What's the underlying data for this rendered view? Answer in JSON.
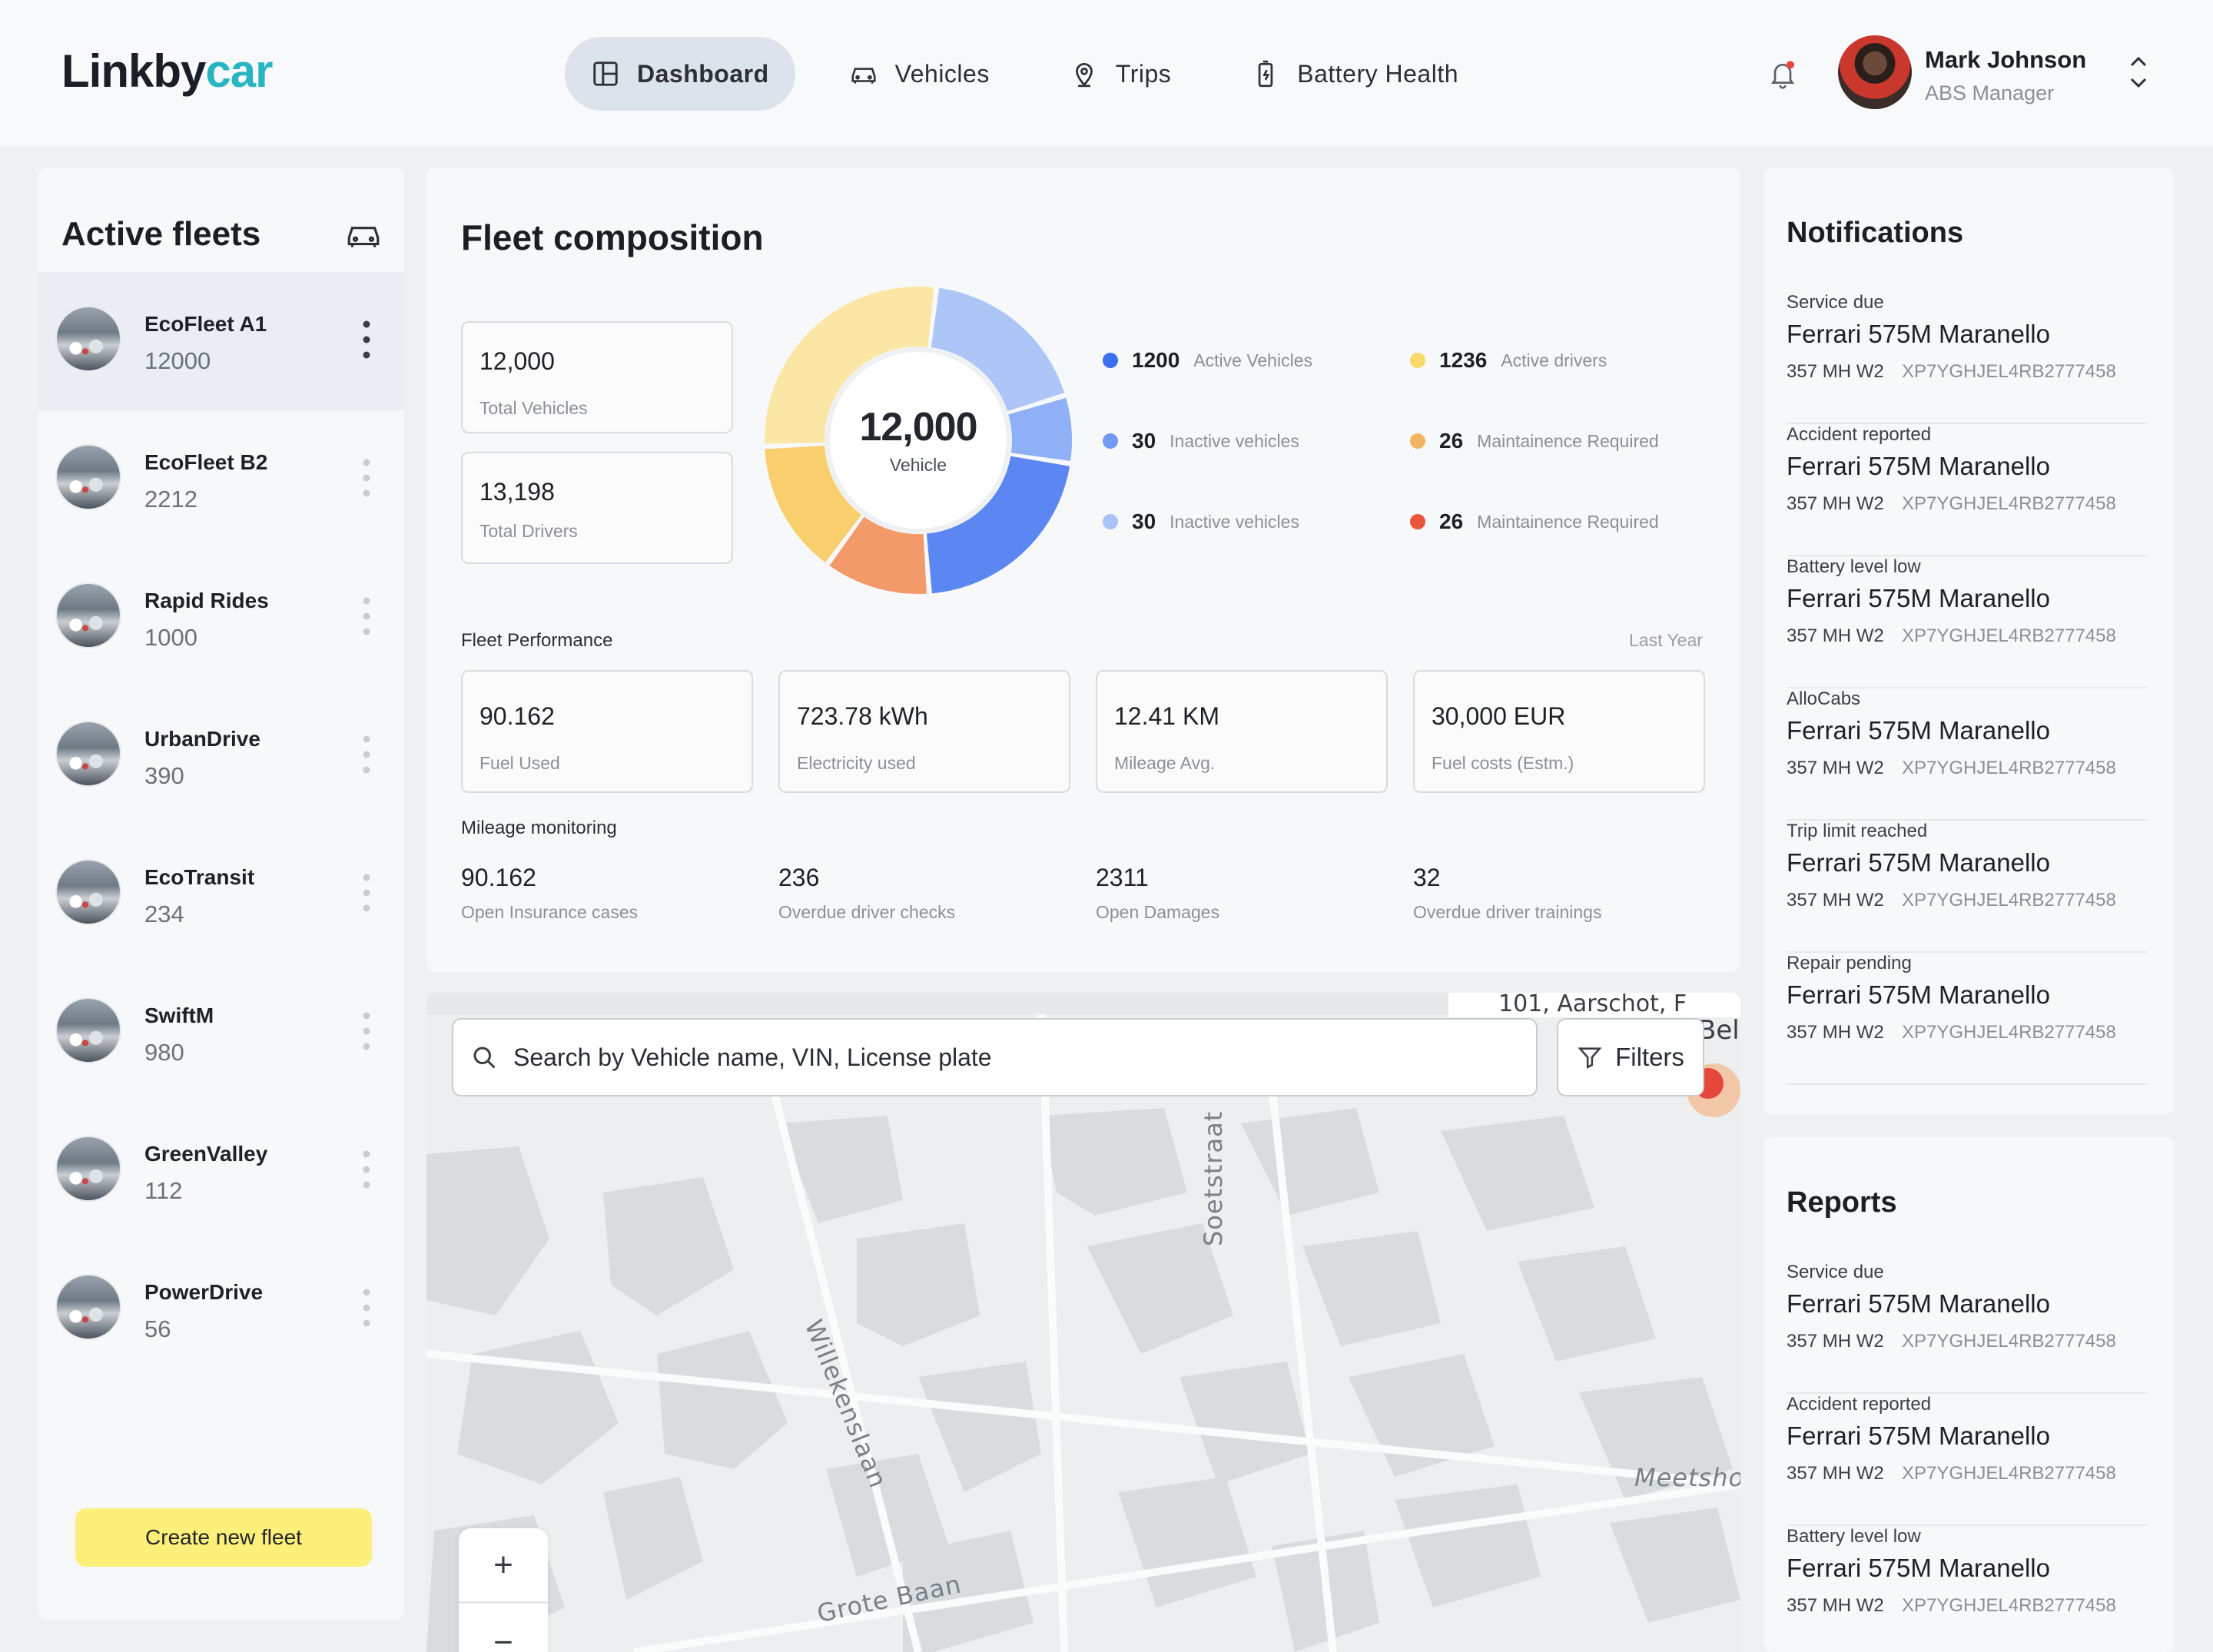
{
  "header": {
    "logo_main": "Linkby",
    "logo_accent": "car",
    "nav": [
      {
        "label": "Dashboard",
        "icon": "dashboard-icon",
        "active": true
      },
      {
        "label": "Vehicles",
        "icon": "car-icon",
        "active": false
      },
      {
        "label": "Trips",
        "icon": "location-pin-icon",
        "active": false
      },
      {
        "label": "Battery Health",
        "icon": "battery-icon",
        "active": false
      }
    ],
    "user": {
      "name": "Mark Johnson",
      "role": "ABS Manager"
    }
  },
  "fleets": {
    "title": "Active fleets",
    "items": [
      {
        "name": "EcoFleet A1",
        "count": "12000",
        "selected": true
      },
      {
        "name": "EcoFleet B2",
        "count": "2212",
        "selected": false
      },
      {
        "name": "Rapid Rides",
        "count": "1000",
        "selected": false
      },
      {
        "name": "UrbanDrive",
        "count": "390",
        "selected": false
      },
      {
        "name": "EcoTransit",
        "count": "234",
        "selected": false
      },
      {
        "name": "SwiftM",
        "count": "980",
        "selected": false
      },
      {
        "name": "GreenValley",
        "count": "112",
        "selected": false
      },
      {
        "name": "PowerDrive",
        "count": "56",
        "selected": false
      }
    ],
    "create_label": "Create new fleet"
  },
  "composition": {
    "title": "Fleet composition",
    "total_vehicles": {
      "value": "12,000",
      "label": "Total Vehicles"
    },
    "total_drivers": {
      "value": "13,198",
      "label": "Total Drivers"
    },
    "donut_center": {
      "value": "12,000",
      "label": "Vehicle"
    },
    "legend": [
      {
        "value": "1200",
        "label": "Active Vehicles",
        "color": "#3d6ff5"
      },
      {
        "value": "1236",
        "label": "Active drivers",
        "color": "#f7da6b"
      },
      {
        "value": "30",
        "label": "Inactive vehicles",
        "color": "#6f9af5"
      },
      {
        "value": "26",
        "label": "Maintainence Required",
        "color": "#f4b363"
      },
      {
        "value": "30",
        "label": "Inactive vehicles",
        "color": "#a9c3f6"
      },
      {
        "value": "26",
        "label": "Maintainence Required",
        "color": "#e8563b"
      }
    ],
    "performance": {
      "label": "Fleet Performance",
      "period": "Last Year",
      "items": [
        {
          "value": "90.162",
          "label": "Fuel Used"
        },
        {
          "value": "723.78 kWh",
          "label": "Electricity used"
        },
        {
          "value": "12.41 KM",
          "label": "Mileage Avg."
        },
        {
          "value": "30,000 EUR",
          "label": "Fuel costs (Estm.)"
        }
      ]
    },
    "mileage": {
      "label": "Mileage monitoring",
      "items": [
        {
          "value": "90.162",
          "label": "Open Insurance cases"
        },
        {
          "value": "236",
          "label": "Overdue driver checks"
        },
        {
          "value": "2311",
          "label": "Open Damages"
        },
        {
          "value": "32",
          "label": "Overdue driver trainings"
        }
      ]
    }
  },
  "chart_data": {
    "type": "pie",
    "title": "",
    "center_label": "12,000",
    "center_sublabel": "Vehicle",
    "segments_note": "donut segments without printed values",
    "colors": [
      "#aec6f7",
      "#8fb0f6",
      "#5c86f2",
      "#f29a6a",
      "#f8cf6c",
      "#fbe6a6"
    ],
    "shares": [
      0.18,
      0.07,
      0.21,
      0.11,
      0.14,
      0.27
    ]
  },
  "map": {
    "search_placeholder": "Search by Vehicle name, VIN, License plate",
    "filters_label": "Filters",
    "streets": [
      "Willekenslaan",
      "Soetstraat",
      "Grote Baan",
      "Meetsho"
    ],
    "overlay_text": "Belg",
    "overlay_text_top": "101, Aarschot, F",
    "zoom_in": "+",
    "zoom_out": "−"
  },
  "notifications": {
    "title": "Notifications",
    "items": [
      {
        "type": "Service due",
        "car": "Ferrari 575M Maranello",
        "plate": "357 MH W2",
        "vin": "XP7YGHJEL4RB2777458"
      },
      {
        "type": "Accident reported",
        "car": "Ferrari 575M Maranello",
        "plate": "357 MH W2",
        "vin": "XP7YGHJEL4RB2777458"
      },
      {
        "type": "Battery level low",
        "car": "Ferrari 575M Maranello",
        "plate": "357 MH W2",
        "vin": "XP7YGHJEL4RB2777458"
      },
      {
        "type": "AlloCabs",
        "car": "Ferrari 575M Maranello",
        "plate": "357 MH W2",
        "vin": "XP7YGHJEL4RB2777458"
      },
      {
        "type": "Trip limit reached",
        "car": "Ferrari 575M Maranello",
        "plate": "357 MH W2",
        "vin": "XP7YGHJEL4RB2777458"
      },
      {
        "type": "Repair pending",
        "car": "Ferrari 575M Maranello",
        "plate": "357 MH W2",
        "vin": "XP7YGHJEL4RB2777458"
      }
    ]
  },
  "reports": {
    "title": "Reports",
    "items": [
      {
        "type": "Service due",
        "car": "Ferrari 575M Maranello",
        "plate": "357 MH W2",
        "vin": "XP7YGHJEL4RB2777458"
      },
      {
        "type": "Accident reported",
        "car": "Ferrari 575M Maranello",
        "plate": "357 MH W2",
        "vin": "XP7YGHJEL4RB2777458"
      },
      {
        "type": "Battery level low",
        "car": "Ferrari 575M Maranello",
        "plate": "357 MH W2",
        "vin": "XP7YGHJEL4RB2777458"
      }
    ]
  }
}
